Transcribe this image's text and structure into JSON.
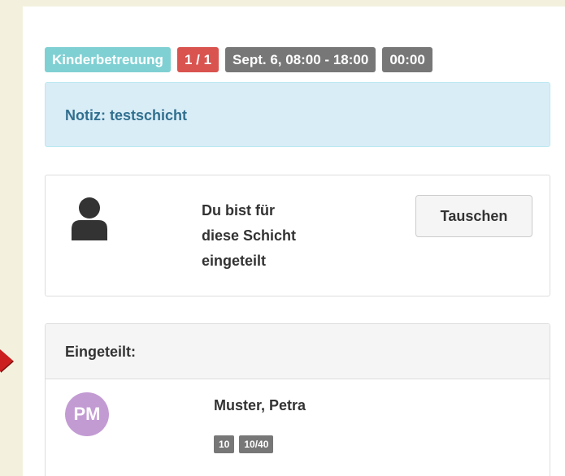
{
  "shift": {
    "labels": {
      "category": "Kinderbetreuung",
      "fill": "1 / 1",
      "time_range": "Sept. 6, 08:00 - 18:00",
      "duration": "00:00"
    },
    "note": "Notiz: testschicht"
  },
  "assignment_card": {
    "icon": "person-icon",
    "text_lines": [
      "Du bist für",
      "diese Schicht",
      "eingeteilt"
    ],
    "swap_button_label": "Tauschen"
  },
  "assigned": {
    "heading": "Eingeteilt:",
    "members": [
      {
        "initials": "PM",
        "name": "Muster, Petra",
        "avatar_color": "#c39bd3",
        "badges": [
          "10",
          "10/40"
        ]
      }
    ]
  },
  "colors": {
    "category_label": "#7fd0d3",
    "fill_label": "#d9534f",
    "neutral_label": "#777777",
    "note_background": "#d9edf7",
    "note_text": "#31708f",
    "page_background": "#f3f1de",
    "arrow": "#cc1f1f"
  }
}
